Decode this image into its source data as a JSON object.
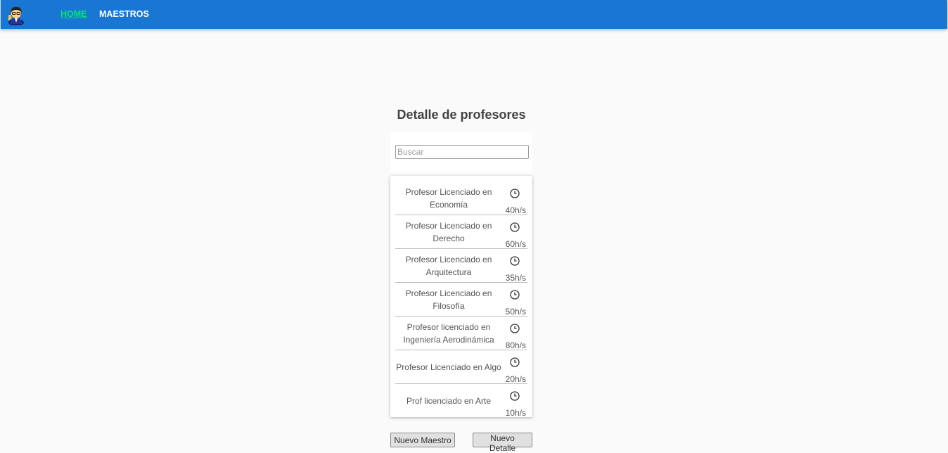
{
  "nav": {
    "home_label": "HOME",
    "maestros_label": "MAESTROS",
    "logo_icon": "teacher-avatar-icon"
  },
  "main": {
    "title": "Detalle de profesores",
    "search": {
      "placeholder": "Buscar",
      "value": ""
    },
    "items": [
      {
        "title": "Profesor Licenciado en Economía",
        "hours": "40h/s"
      },
      {
        "title": "Profesor Licenciado en Derecho",
        "hours": "60h/s"
      },
      {
        "title": "Profesor Licenciado en Arquitectura",
        "hours": "35h/s"
      },
      {
        "title": "Profesor Licenciado en Filosofía",
        "hours": "50h/s"
      },
      {
        "title": "Profesor licenciado en Ingeniería Aerodinámica",
        "hours": "80h/s"
      },
      {
        "title": "Profesor Licenciado en Algo",
        "hours": "20h/s"
      },
      {
        "title": "Prof licenciado en Arte",
        "hours": "10h/s"
      }
    ],
    "item_icon": "clock-icon"
  },
  "buttons": {
    "new_teacher": "Nuevo Maestro",
    "new_detail": "Nuevo Detalle"
  },
  "colors": {
    "navbar": "#1976d2",
    "active_link": "#00e676"
  }
}
